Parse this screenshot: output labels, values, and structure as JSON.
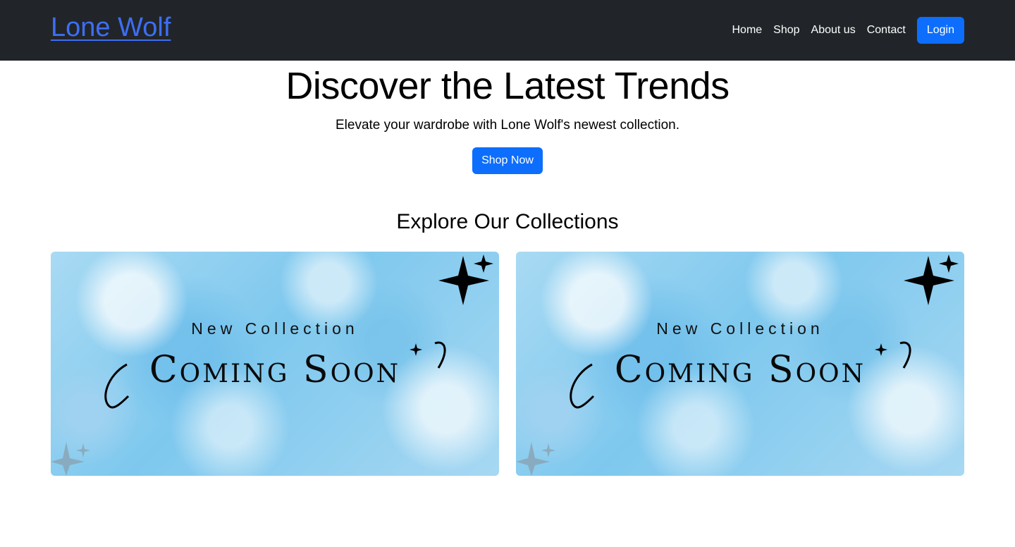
{
  "nav": {
    "brand": "Lone Wolf",
    "links": [
      "Home",
      "Shop",
      "About us",
      "Contact"
    ],
    "login_label": "Login"
  },
  "hero": {
    "title": "Discover the Latest Trends",
    "subtitle": "Elevate your wardrobe with Lone Wolf's newest collection.",
    "cta_label": "Shop Now"
  },
  "collections": {
    "heading": "Explore Our Collections",
    "cards": [
      {
        "kicker": "New Collection",
        "title": "Coming Soon"
      },
      {
        "kicker": "New Collection",
        "title": "Coming Soon"
      }
    ]
  },
  "colors": {
    "navbar_bg": "#212529",
    "brand_link": "#3d6ef5",
    "primary_button": "#0d6efd",
    "card_watercolor": "#8fd0f0"
  }
}
